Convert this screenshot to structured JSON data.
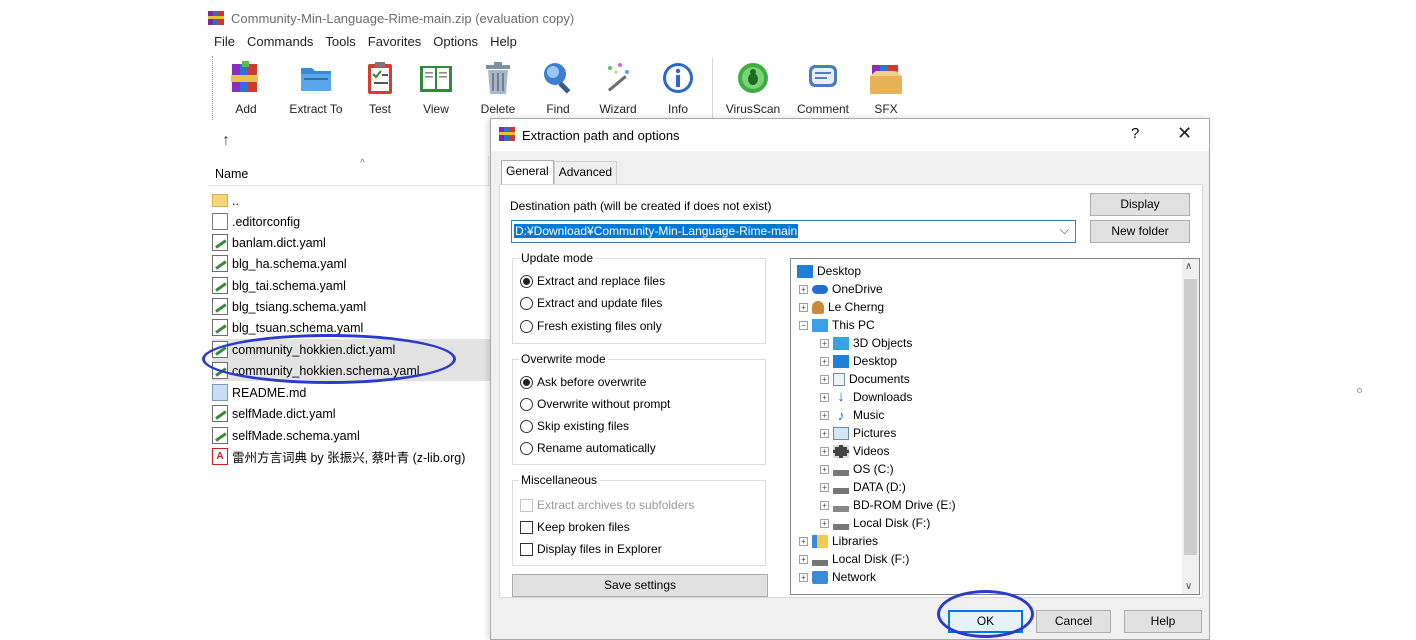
{
  "window": {
    "title": "Community-Min-Language-Rime-main.zip (evaluation copy)"
  },
  "menu": [
    "File",
    "Commands",
    "Tools",
    "Favorites",
    "Options",
    "Help"
  ],
  "toolbar": [
    {
      "label": "Add",
      "icon": "add-archive-icon"
    },
    {
      "label": "Extract To",
      "icon": "extract-folder-icon"
    },
    {
      "label": "Test",
      "icon": "test-clipboard-icon"
    },
    {
      "label": "View",
      "icon": "view-book-icon"
    },
    {
      "label": "Delete",
      "icon": "trash-icon"
    },
    {
      "label": "Find",
      "icon": "magnifier-icon"
    },
    {
      "label": "Wizard",
      "icon": "magic-wand-icon"
    },
    {
      "label": "Info",
      "icon": "info-icon"
    },
    {
      "label": "VirusScan",
      "icon": "virus-scan-icon"
    },
    {
      "label": "Comment",
      "icon": "comment-icon"
    },
    {
      "label": "SFX",
      "icon": "sfx-box-icon"
    }
  ],
  "filelist": {
    "column_name": "Name",
    "files": [
      {
        "name": "..",
        "type": "folder"
      },
      {
        "name": ".editorconfig",
        "type": "blank"
      },
      {
        "name": "banlam.dict.yaml",
        "type": "yaml"
      },
      {
        "name": "blg_ha.schema.yaml",
        "type": "yaml"
      },
      {
        "name": "blg_tai.schema.yaml",
        "type": "yaml"
      },
      {
        "name": "blg_tsiang.schema.yaml",
        "type": "yaml"
      },
      {
        "name": "blg_tsuan.schema.yaml",
        "type": "yaml"
      },
      {
        "name": "community_hokkien.dict.yaml",
        "type": "yaml"
      },
      {
        "name": "community_hokkien.schema.yaml",
        "type": "yaml"
      },
      {
        "name": "README.md",
        "type": "md"
      },
      {
        "name": "selfMade.dict.yaml",
        "type": "yaml"
      },
      {
        "name": "selfMade.schema.yaml",
        "type": "yaml"
      },
      {
        "name": "雷州方言词典 by 张振兴, 蔡叶青 (z-lib.org)",
        "type": "pdf"
      }
    ]
  },
  "dialog": {
    "title": "Extraction path and options",
    "help_glyph": "?",
    "close_glyph": "✕",
    "tabs": [
      "General",
      "Advanced"
    ],
    "destination_label": "Destination path (will be created if does not exist)",
    "destination_value": "D:¥Download¥Community-Min-Language-Rime-main",
    "display_button": "Display",
    "new_folder_button": "New folder",
    "update_mode": {
      "title": "Update mode",
      "options": [
        "Extract and replace files",
        "Extract and update files",
        "Fresh existing files only"
      ],
      "selected": 0
    },
    "overwrite_mode": {
      "title": "Overwrite mode",
      "options": [
        "Ask before overwrite",
        "Overwrite without prompt",
        "Skip existing files",
        "Rename automatically"
      ],
      "selected": 0
    },
    "misc": {
      "title": "Miscellaneous",
      "options": [
        {
          "label": "Extract archives to subfolders",
          "checked": false,
          "disabled": true
        },
        {
          "label": "Keep broken files",
          "checked": false,
          "disabled": false
        },
        {
          "label": "Display files in Explorer",
          "checked": false,
          "disabled": false
        }
      ]
    },
    "save_settings_button": "Save settings",
    "ok_button": "OK",
    "cancel_button": "Cancel",
    "help_button": "Help",
    "tree": [
      {
        "label": "Desktop",
        "icon": "desktop-icon",
        "expander": ""
      },
      {
        "label": "OneDrive",
        "icon": "cloud-icon",
        "expander": "+"
      },
      {
        "label": "Le Cherng",
        "icon": "user-icon",
        "expander": "+"
      },
      {
        "label": "This PC",
        "icon": "computer-icon",
        "expander": "−"
      },
      {
        "label": "3D Objects",
        "icon": "cube-icon",
        "expander": "+"
      },
      {
        "label": "Desktop",
        "icon": "desktop-icon",
        "expander": "+"
      },
      {
        "label": "Documents",
        "icon": "document-icon",
        "expander": "+"
      },
      {
        "label": "Downloads",
        "icon": "download-icon",
        "expander": "+"
      },
      {
        "label": "Music",
        "icon": "music-icon",
        "expander": "+"
      },
      {
        "label": "Pictures",
        "icon": "pictures-icon",
        "expander": "+"
      },
      {
        "label": "Videos",
        "icon": "videos-icon",
        "expander": "+"
      },
      {
        "label": "OS (C:)",
        "icon": "drive-icon",
        "expander": "+"
      },
      {
        "label": "DATA (D:)",
        "icon": "drive-icon",
        "expander": "+"
      },
      {
        "label": "BD-ROM Drive (E:)",
        "icon": "optical-drive-icon",
        "expander": "+"
      },
      {
        "label": "Local Disk (F:)",
        "icon": "drive-icon",
        "expander": "+"
      },
      {
        "label": "Libraries",
        "icon": "libraries-icon",
        "expander": "+"
      },
      {
        "label": "Local Disk (F:)",
        "icon": "drive-icon",
        "expander": "+"
      },
      {
        "label": "Network",
        "icon": "network-icon",
        "expander": "+"
      }
    ]
  },
  "colors": {
    "annotation": "#2b3acb",
    "selection": "#0078d7"
  }
}
